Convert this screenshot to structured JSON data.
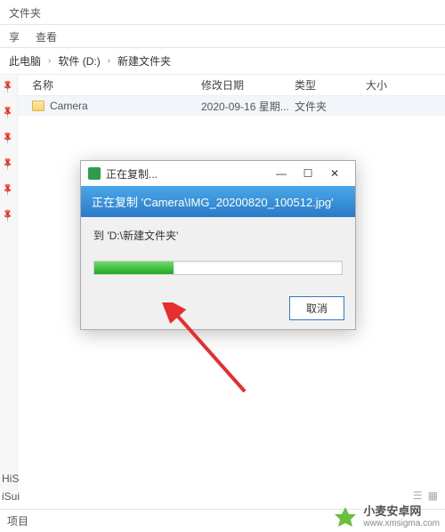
{
  "topbar": {
    "label": "文件夹"
  },
  "menu": {
    "share": "享",
    "view": "查看"
  },
  "breadcrumb": {
    "root": "此电脑",
    "drive": "软件 (D:)",
    "folder": "新建文件夹"
  },
  "columns": {
    "name": "名称",
    "date": "修改日期",
    "type": "类型",
    "size": "大小"
  },
  "row": {
    "name": "Camera",
    "date": "2020-09-16 星期...",
    "type": "文件夹"
  },
  "dialog": {
    "title": "正在复制...",
    "copying": "正在复制 'Camera\\IMG_20200820_100512.jpg'",
    "to": "到 'D:\\新建文件夹'",
    "cancel": "取消"
  },
  "bottom": {
    "his": "HiS",
    "isui": "iSui",
    "item": "项目"
  },
  "watermark": {
    "name": "小麦安卓网",
    "url": "www.xmsigma.com"
  }
}
